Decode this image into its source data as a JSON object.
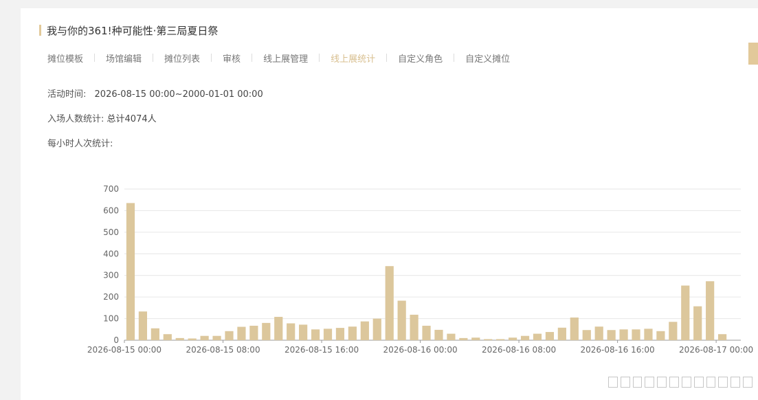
{
  "header": {
    "title": "我与你的361!种可能性·第三局夏日祭"
  },
  "tabs": [
    {
      "label": "摊位模板",
      "active": false
    },
    {
      "label": "场馆编辑",
      "active": false
    },
    {
      "label": "摊位列表",
      "active": false
    },
    {
      "label": "审核",
      "active": false
    },
    {
      "label": "线上展管理",
      "active": false
    },
    {
      "label": "线上展统计",
      "active": true
    },
    {
      "label": "自定义角色",
      "active": false
    },
    {
      "label": "自定义摊位",
      "active": false
    }
  ],
  "info": {
    "activity_time_label": "活动时间:",
    "activity_time_value": "2026-08-15 00:00~2000-01-01 00:00",
    "attendance_label": "入场人数统计:",
    "attendance_value": "总计4074人",
    "hourly_label": "每小时人次统计:"
  },
  "colors": {
    "accent": "#e2c99a",
    "bar": "#dcc79c",
    "active_tab": "#d8bf8f"
  },
  "chart_data": {
    "type": "bar",
    "ylim": [
      0,
      700
    ],
    "yticks": [
      "0",
      "100",
      "200",
      "300",
      "400",
      "500",
      "600",
      "700"
    ],
    "x_labels": [
      "2026-08-15 00:00",
      "2026-08-15 08:00",
      "2026-08-15 16:00",
      "2026-08-16 00:00",
      "2026-08-16 08:00",
      "2026-08-16 16:00",
      "2026-08-17 00:00"
    ],
    "x_label_every": 8,
    "values": [
      635,
      133,
      55,
      28,
      10,
      8,
      20,
      20,
      42,
      62,
      67,
      80,
      108,
      78,
      72,
      50,
      53,
      57,
      63,
      87,
      100,
      343,
      183,
      118,
      67,
      48,
      30,
      10,
      12,
      5,
      5,
      12,
      20,
      30,
      38,
      58,
      105,
      47,
      63,
      47,
      50,
      50,
      53,
      42,
      85,
      253,
      157,
      273,
      28
    ]
  }
}
